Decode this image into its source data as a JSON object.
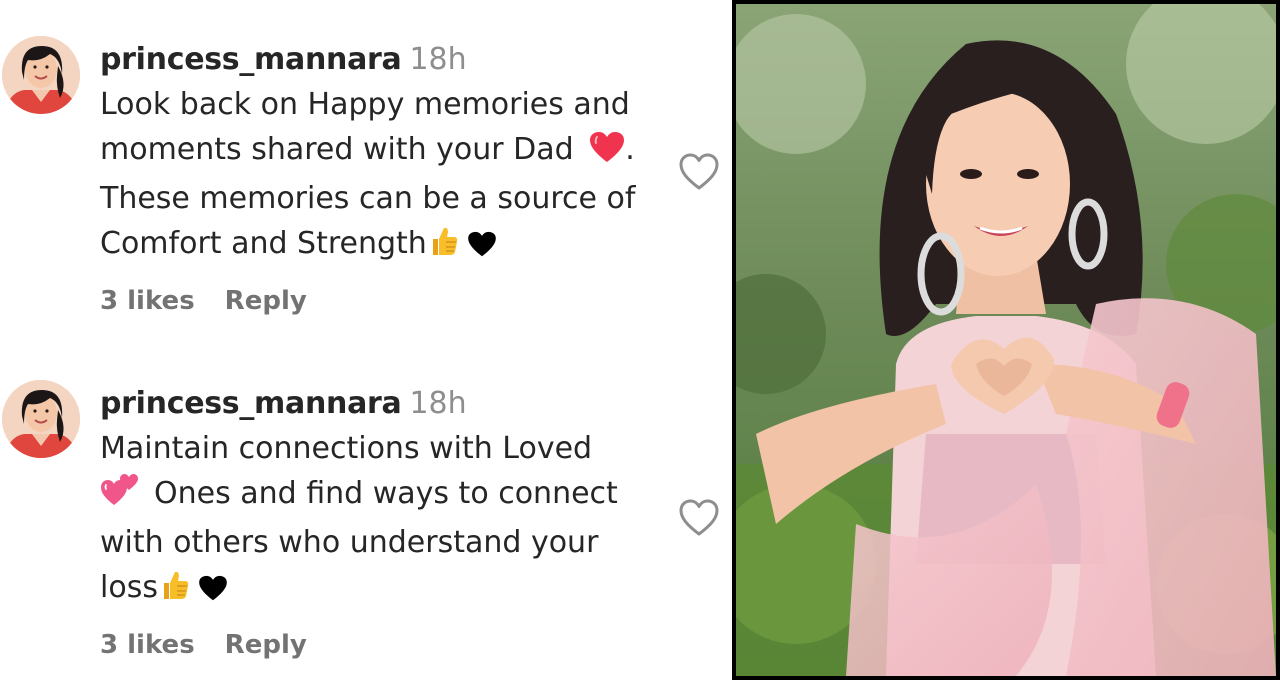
{
  "comments": [
    {
      "username": "princess_mannara",
      "time": "18h",
      "lines": [
        "Look back on Happy memories and",
        "moments shared with your Dad",
        ". ",
        "These memories can be a source of",
        "Comfort and Strength"
      ],
      "emojis": [
        "red-heart-emoji",
        "thumbs-up-emoji",
        "black-heart-emoji"
      ],
      "likes": "3 likes",
      "reply": "Reply"
    },
    {
      "username": "princess_mannara",
      "time": "18h",
      "lines": [
        "Maintain connections with Loved",
        "Ones and find ways to connect",
        "with others who understand your",
        "loss"
      ],
      "emojis": [
        "two-hearts-emoji",
        "thumbs-up-emoji",
        "black-heart-emoji"
      ],
      "likes": "3 likes",
      "reply": "Reply"
    }
  ],
  "colors": {
    "username": "#262626",
    "secondary": "#8e8e8e",
    "heart_red": "#f0344f",
    "photo_border": "#000000"
  },
  "icons": {
    "like": "heart-outline-icon",
    "avatar": "profile-avatar"
  }
}
